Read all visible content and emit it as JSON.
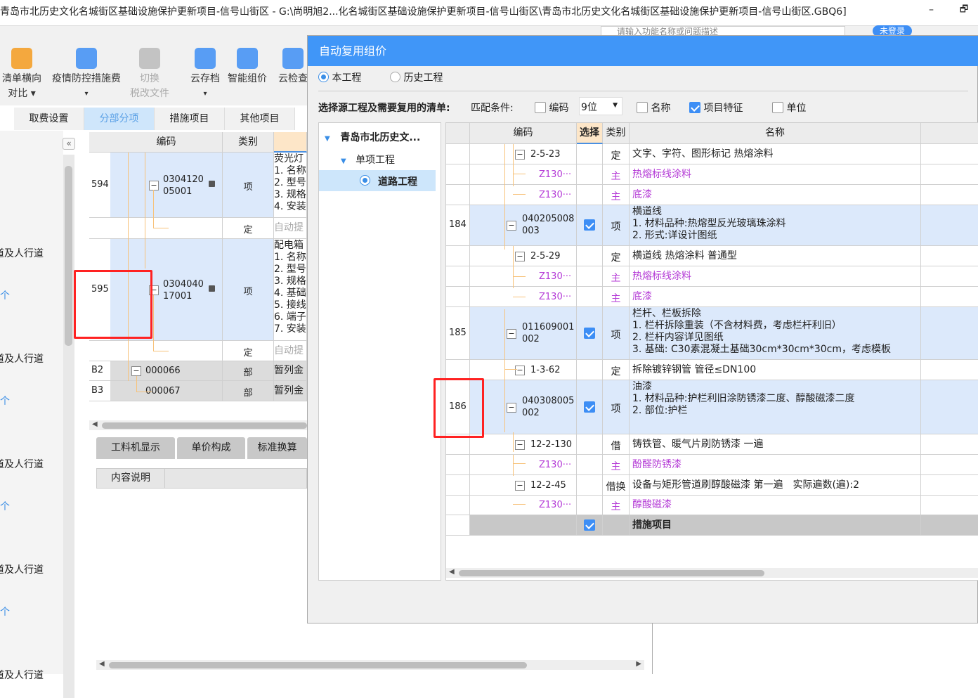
{
  "window": {
    "title": "青岛市北历史文化名城街区基础设施保护更新项目-信号山街区 - G:\\尚明旭2...化名城街区基础设施保护更新项目-信号山街区\\青岛市北历史文化名城街区基础设施保护更新项目-信号山街区.GBQ6]",
    "minimize": "–",
    "restore": "🗗"
  },
  "search": {
    "placeholder": "请输入功能名称或问题描述"
  },
  "login": "未登录",
  "toolbar": [
    {
      "l1": "清单横向",
      "l2": "对比 ▾",
      "icon": "compare-icon",
      "color": "#f59b1e"
    },
    {
      "l1": "疫情防控措施费",
      "l2": "▾",
      "icon": "epidemic-fee-icon",
      "color": "#3d8ef5"
    },
    {
      "l1": "切换",
      "l2": "税改文件",
      "icon": "tax-switch-icon",
      "color": "#bbb"
    },
    {
      "l1": "云存档",
      "l2": "▾",
      "icon": "cloud-save-icon",
      "color": "#3d8ef5"
    },
    {
      "l1": "智能组价",
      "l2": "",
      "icon": "smart-price-icon",
      "color": "#3d8ef5"
    },
    {
      "l1": "云检查",
      "l2": "",
      "icon": "cloud-check-icon",
      "color": "#3d8ef5"
    }
  ],
  "tabs": [
    "取费设置",
    "分部分项",
    "措施项目",
    "其他项目"
  ],
  "sidebar": {
    "collapse": "«",
    "items": [
      "道及人行道",
      "个",
      "道及人行道",
      "个",
      "道及人行道",
      "个",
      "道及人行道",
      "个",
      "道及人行道"
    ]
  },
  "main_grid": {
    "headers": [
      "编码",
      "类别"
    ],
    "rows": [
      {
        "no": "594",
        "code": "0304120\n05001",
        "type": "项",
        "name": "荧光灯\n1. 名称\n2. 型号\n3. 规格\n4. 安装",
        "kind": "item"
      },
      {
        "no": "",
        "code": "",
        "type": "定",
        "name": "自动提",
        "kind": "quota"
      },
      {
        "no": "595",
        "code": "0304040\n17001",
        "type": "项",
        "name": "配电箱\n1. 名称\n2. 型号\n3. 规格\n4. 基础\n5. 接线\n6. 端子\n7. 安装",
        "kind": "item"
      },
      {
        "no": "",
        "code": "",
        "type": "定",
        "name": "自动提",
        "kind": "quota"
      },
      {
        "no": "B2",
        "code": "000066",
        "type": "部",
        "name": "暂列金",
        "kind": "part"
      },
      {
        "no": "B3",
        "code": "000067",
        "type": "部",
        "name": "暂列金",
        "kind": "part"
      }
    ]
  },
  "bottom_tabs": [
    "工料机显示",
    "单价构成",
    "标准换算"
  ],
  "content_label": "内容说明",
  "dialog": {
    "title": "自动复用组价",
    "radio_current": "本工程",
    "radio_history": "历史工程",
    "select_label": "选择源工程及需要复用的清单:",
    "match_label": "匹配条件:",
    "code_cb": "编码",
    "code_digits": "9位",
    "name_cb": "名称",
    "feature_cb": "项目特征",
    "unit_cb": "单位",
    "tree": {
      "root": "青岛市北历史文...",
      "sub": "单项工程",
      "leaf": "道路工程"
    },
    "headers": [
      "编码",
      "选择",
      "类别",
      "名称"
    ],
    "rows": [
      {
        "no": "",
        "code": "2-5-23",
        "sel": false,
        "type": "定",
        "name": "文字、字符、图形标记 热熔涂料",
        "level": 2,
        "kind": "quota"
      },
      {
        "no": "",
        "code": "Z130···",
        "sel": false,
        "type": "主",
        "name": "热熔标线涂料",
        "level": 3,
        "kind": "main"
      },
      {
        "no": "",
        "code": "Z130···",
        "sel": false,
        "type": "主",
        "name": "底漆",
        "level": 3,
        "kind": "main"
      },
      {
        "no": "184",
        "code": "040205008\n003",
        "sel": true,
        "type": "项",
        "name": "横道线\n1. 材料品种:热熔型反光玻璃珠涂料\n2. 形式:详设计图纸",
        "level": 1,
        "kind": "item"
      },
      {
        "no": "",
        "code": "2-5-29",
        "sel": false,
        "type": "定",
        "name": "横道线 热熔涂料 普通型",
        "level": 2,
        "kind": "quota"
      },
      {
        "no": "",
        "code": "Z130···",
        "sel": false,
        "type": "主",
        "name": "热熔标线涂料",
        "level": 3,
        "kind": "main"
      },
      {
        "no": "",
        "code": "Z130···",
        "sel": false,
        "type": "主",
        "name": "底漆",
        "level": 3,
        "kind": "main"
      },
      {
        "no": "185",
        "code": "011609001\n002",
        "sel": true,
        "type": "项",
        "name": "栏杆、栏板拆除\n1. 栏杆拆除重装（不含材料费，考虑栏杆利旧）\n2. 栏杆内容详见图纸\n3. 基础: C30素混凝土基础30cm*30cm*30cm，考虑模板",
        "level": 1,
        "kind": "item"
      },
      {
        "no": "",
        "code": "1-3-62",
        "sel": false,
        "type": "定",
        "name": "拆除镀锌钢管 管径≤DN100",
        "level": 2,
        "kind": "quota"
      },
      {
        "no": "186",
        "code": "040308005\n002",
        "sel": true,
        "type": "项",
        "name": "油漆\n1. 材料品种:护栏利旧涂防锈漆二度、醇酸磁漆二度\n2. 部位:护栏",
        "level": 1,
        "kind": "item"
      },
      {
        "no": "",
        "code": "12-2-130",
        "sel": false,
        "type": "借",
        "name": "铸铁管、暖气片刷防锈漆 一遍",
        "level": 2,
        "kind": "quota"
      },
      {
        "no": "",
        "code": "Z130···",
        "sel": false,
        "type": "主",
        "name": "酚醛防锈漆",
        "level": 3,
        "kind": "main"
      },
      {
        "no": "",
        "code": "12-2-45",
        "sel": false,
        "type": "借换",
        "name": "设备与矩形管道刷醇酸磁漆 第一遍　实际遍数(遍):2",
        "level": 2,
        "kind": "quota"
      },
      {
        "no": "",
        "code": "Z130···",
        "sel": false,
        "type": "主",
        "name": "醇酸磁漆",
        "level": 3,
        "kind": "main"
      },
      {
        "no": "",
        "code": "",
        "sel": true,
        "type": "",
        "name": "措施项目",
        "level": 0,
        "kind": "section"
      }
    ]
  },
  "colors": {
    "accent": "#4096f8",
    "highlight": "#dce9fb",
    "purple": "#b43ad6",
    "annotation": "#ff2222"
  }
}
